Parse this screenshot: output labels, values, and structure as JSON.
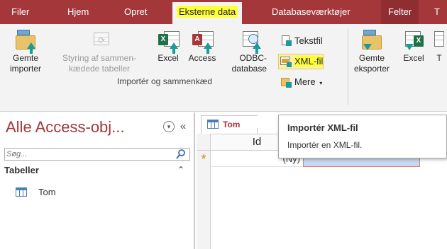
{
  "ribbon_tabs": [
    {
      "label": "Filer"
    },
    {
      "label": "Hjem"
    },
    {
      "label": "Opret"
    },
    {
      "label": "Eksterne data",
      "active": true
    },
    {
      "label": "Databaseværktøjer"
    },
    {
      "label": "Felter"
    },
    {
      "label": "T"
    }
  ],
  "import_group": {
    "label": "Importér og sammenkæd",
    "saved_imports": "Gemte\nimporter",
    "linked_table_manager": "Styring af sammen-\nkædede tabeller",
    "excel": "Excel",
    "access": "Access",
    "odbc": "ODBC-\ndatabase",
    "text_file": "Tekstfil",
    "xml_file": "XML-fil",
    "more": "Mere"
  },
  "export_group": {
    "saved_exports": "Gemte\neksporter",
    "excel": "Excel",
    "partial": "T"
  },
  "nav_pane": {
    "title": "Alle Access-obj...",
    "search_placeholder": "Søg...",
    "section": "Tabeller",
    "items": [
      {
        "label": "Tom"
      }
    ]
  },
  "document": {
    "tab_label": "Tom",
    "column_header": "Id",
    "new_row_marker": "*",
    "new_row_value": "(Ny)"
  },
  "tooltip": {
    "title": "Importér XML-fil",
    "body": "Importér en XML-fil."
  },
  "colors": {
    "accent": "#a4373a",
    "highlight": "#ffff3a",
    "selected_cell": "#c8d9ee"
  }
}
